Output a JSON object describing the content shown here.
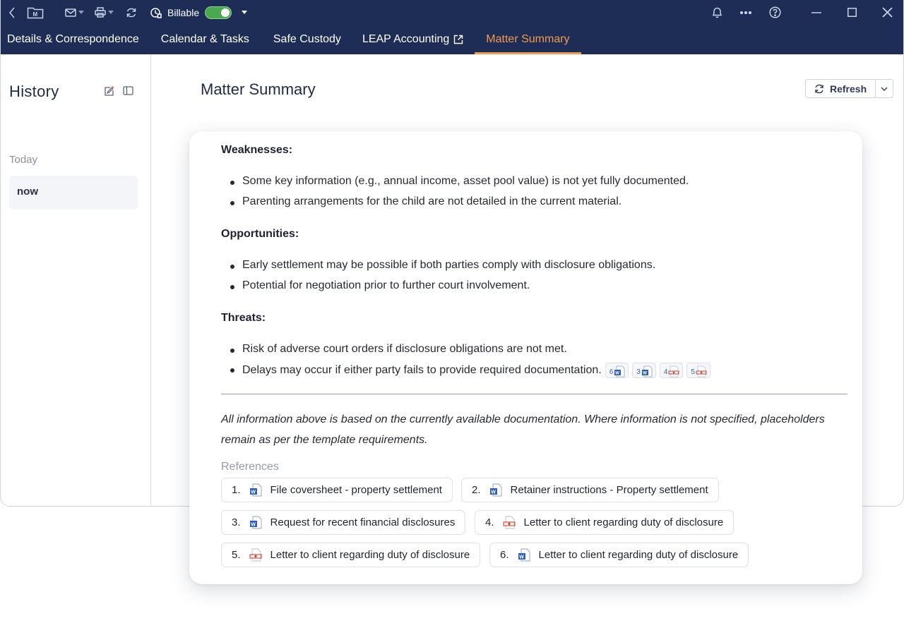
{
  "titlebar": {
    "billable_label": "Billable",
    "billable_on": true,
    "icons": [
      "back-icon",
      "matter-folder-icon",
      "mail-icon",
      "print-icon",
      "sync-icon",
      "clock-billable-icon",
      "bell-icon",
      "more-icon",
      "help-icon",
      "minimize-icon",
      "maximize-icon",
      "close-icon"
    ]
  },
  "tabs": [
    {
      "label": "Details & Correspondence"
    },
    {
      "label": "Calendar & Tasks"
    },
    {
      "label": "Safe Custody"
    },
    {
      "label": "LEAP Accounting"
    },
    {
      "label": "Matter Summary"
    }
  ],
  "sidebar": {
    "title": "History",
    "group_label": "Today",
    "items": [
      {
        "label": "now"
      }
    ]
  },
  "main": {
    "title": "Matter Summary",
    "refresh_label": "Refresh"
  },
  "summary": {
    "sections": [
      {
        "heading": "Weaknesses:",
        "bullets": [
          "Some key information (e.g., annual income, asset pool value) is not yet fully documented.",
          "Parenting arrangements for the child are not detailed in the current material."
        ]
      },
      {
        "heading": "Opportunities:",
        "bullets": [
          "Early settlement may be possible if both parties comply with disclosure obligations.",
          "Potential for negotiation prior to further court involvement."
        ]
      },
      {
        "heading": "Threats:",
        "bullets": [
          "Risk of adverse court orders if disclosure obligations are not met.",
          "Delays may occur if either party fails to provide required documentation."
        ]
      }
    ],
    "citations": [
      {
        "n": "6",
        "type": "word"
      },
      {
        "n": "3",
        "type": "word"
      },
      {
        "n": "4",
        "type": "letter"
      },
      {
        "n": "5",
        "type": "letter"
      }
    ],
    "note": "All information above is based on the currently available documentation. Where information is not specified, placeholders remain as per the template requirements.",
    "references_heading": "References",
    "references": [
      {
        "num": "1.",
        "type": "word",
        "label": "File coversheet - property settlement"
      },
      {
        "num": "2.",
        "type": "word",
        "label": "Retainer instructions - Property settlement"
      },
      {
        "num": "3.",
        "type": "word",
        "label": "Request for recent financial disclosures"
      },
      {
        "num": "4.",
        "type": "letter",
        "label": "Letter to client regarding duty of disclosure"
      },
      {
        "num": "5.",
        "type": "letter",
        "label": "Letter to client regarding duty of disclosure"
      },
      {
        "num": "6.",
        "type": "word",
        "label": "Letter to client regarding duty of disclosure"
      }
    ]
  },
  "colors": {
    "header_bg": "#1d2d55",
    "active_tab": "#f19a4e",
    "toggle_on": "#4aa94e",
    "word_blue": "#2f5fb3",
    "letter_red": "#c8452f"
  }
}
